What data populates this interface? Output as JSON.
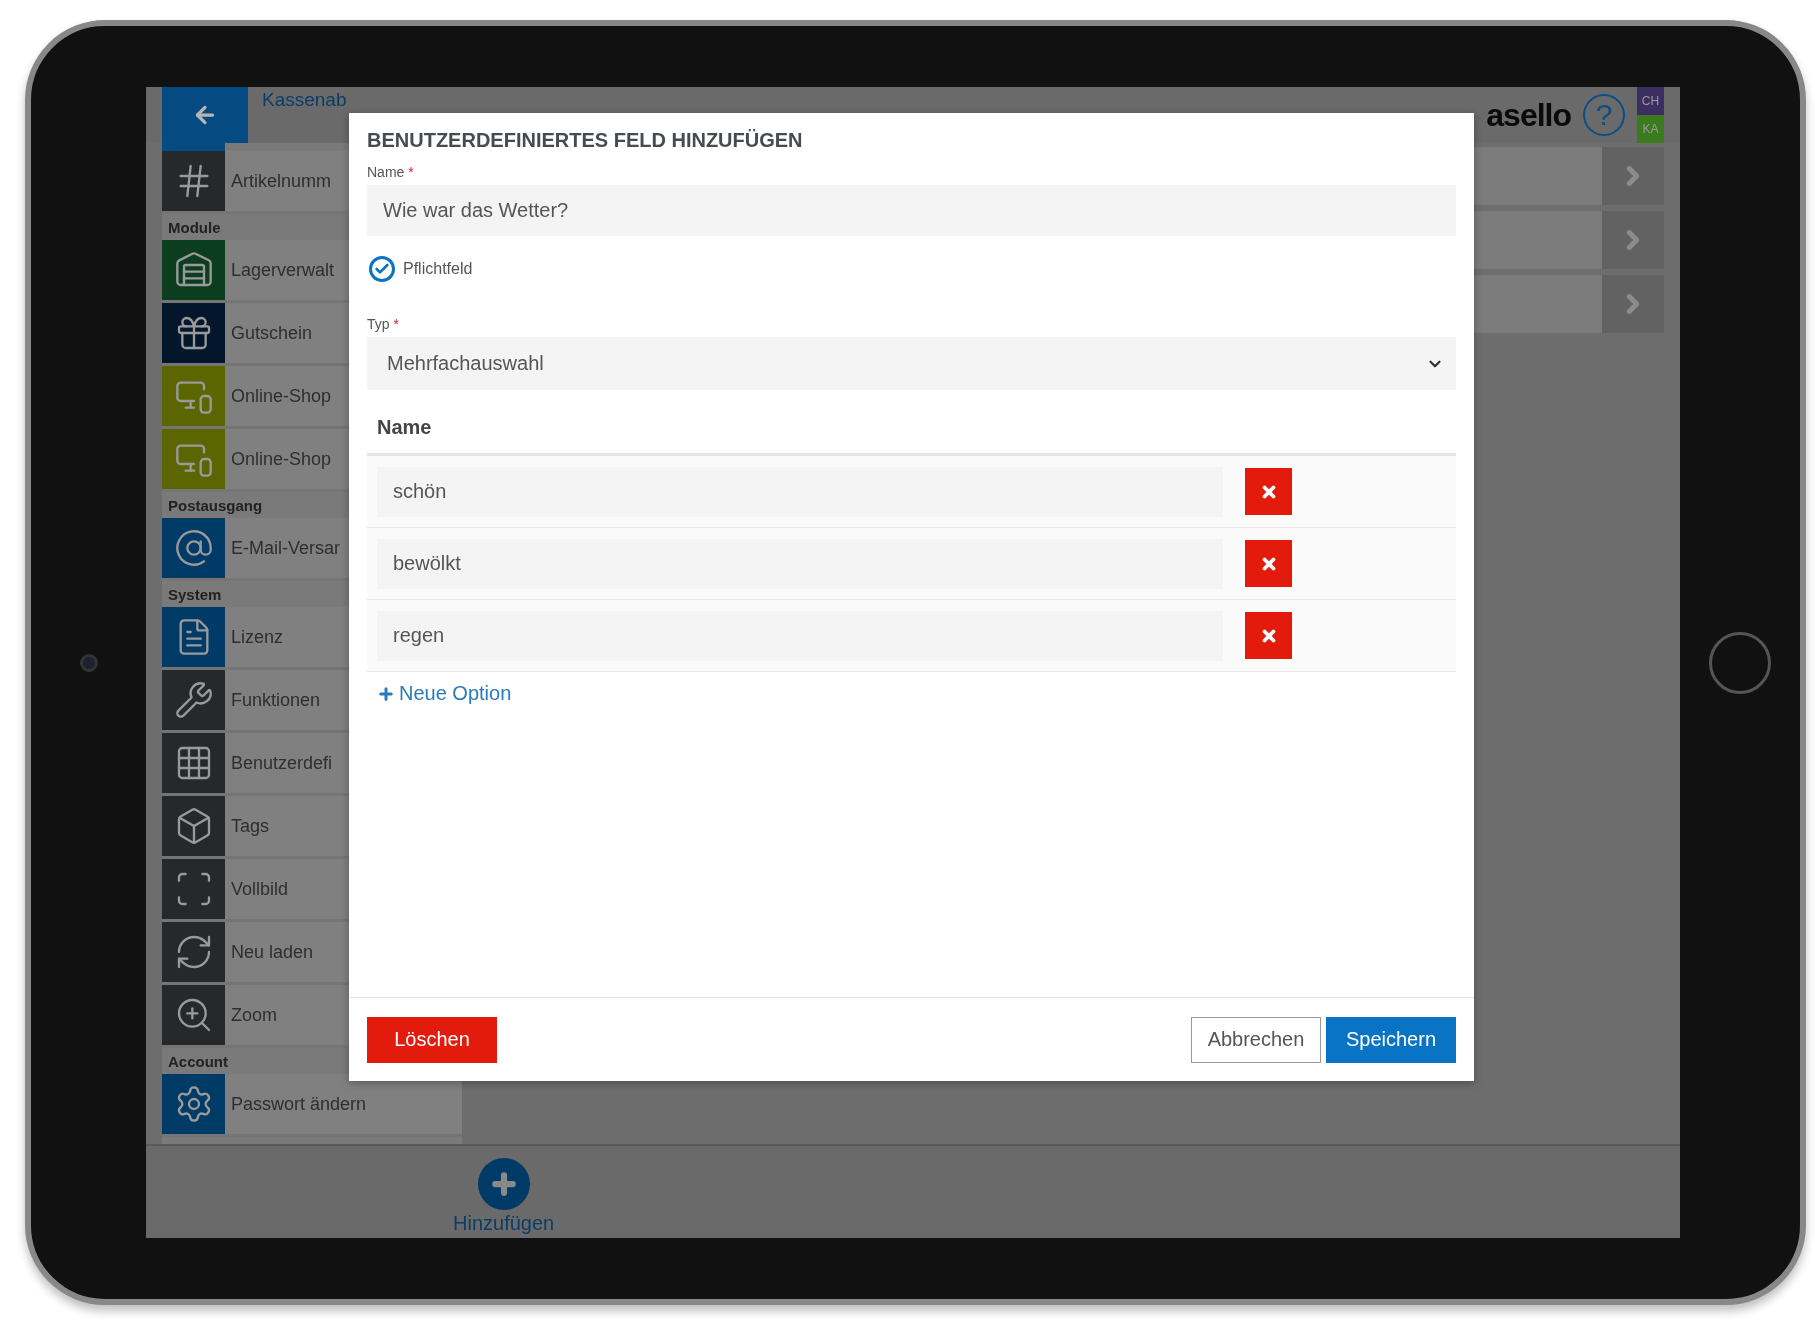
{
  "header": {
    "breadcrumb": "Kassenab",
    "logo": "asello",
    "help": "?",
    "badges": [
      {
        "label": "CH",
        "color": "#3b2e63"
      },
      {
        "label": "KA",
        "color": "#3c7a1e"
      }
    ]
  },
  "sidebar": {
    "sections": [
      {
        "items": [
          {
            "label": "Artikelnumm",
            "color": "#26292c"
          }
        ]
      },
      {
        "title": "Module",
        "items": [
          {
            "label": "Lagerverwalt",
            "color": "#0b3d1f"
          },
          {
            "label": "Gutschein",
            "color": "#04162b"
          },
          {
            "label": "Online-Shop",
            "color": "#5b6600"
          },
          {
            "label": "Online-Shop",
            "color": "#5b6600"
          }
        ]
      },
      {
        "title": "Postausgang",
        "items": [
          {
            "label": "E-Mail-Versar",
            "color": "#003a66"
          }
        ]
      },
      {
        "title": "System",
        "items": [
          {
            "label": "Lizenz",
            "color": "#003a66"
          },
          {
            "label": "Funktionen",
            "color": "#26292c"
          },
          {
            "label": "Benutzerdefi",
            "color": "#26292c"
          },
          {
            "label": "Tags",
            "color": "#26292c"
          },
          {
            "label": "Vollbild",
            "color": "#26292c"
          },
          {
            "label": "Neu laden",
            "color": "#26292c"
          },
          {
            "label": "Zoom",
            "color": "#26292c"
          }
        ]
      },
      {
        "title": "Account",
        "items": [
          {
            "label": "Passwort ändern",
            "color": "#003a66"
          }
        ]
      }
    ]
  },
  "bottom_bar": {
    "add_label": "Hinzufügen"
  },
  "dialog": {
    "title": "BENUTZERDEFINIERTES FELD HINZUFÜGEN",
    "name_field": {
      "label": "Name",
      "required_mark": "*",
      "value": "Wie war das Wetter?"
    },
    "required_checkbox": {
      "label": "Pflichtfeld",
      "checked": true
    },
    "type_field": {
      "label": "Typ",
      "required_mark": "*",
      "value": "Mehrfachauswahl"
    },
    "options_header": "Name",
    "options": [
      {
        "value": "schön"
      },
      {
        "value": "bewölkt"
      },
      {
        "value": "regen"
      }
    ],
    "add_option": "Neue Option",
    "buttons": {
      "delete": "Löschen",
      "cancel": "Abbrechen",
      "save": "Speichern"
    }
  }
}
